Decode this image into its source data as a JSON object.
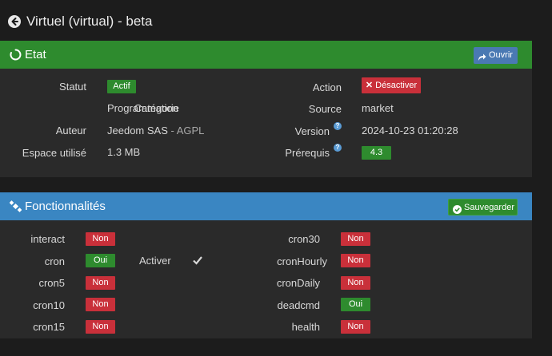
{
  "page": {
    "title": "Virtuel (virtual) - beta"
  },
  "etat": {
    "title": "Etat",
    "open_label": "Ouvrir",
    "status_label": "Statut",
    "status_value": "Actif",
    "category_label": "Catégorie",
    "category_value": "Programmation",
    "author_label": "Auteur",
    "author_name": "Jeedom SAS",
    "author_license": " - AGPL",
    "space_label": "Espace utilisé",
    "space_value": "1.3 MB",
    "action_label": "Action",
    "action_button": "Désactiver",
    "source_label": "Source",
    "source_value": "market",
    "version_label": "Version",
    "version_value": "2024-10-23 01:20:28",
    "prereq_label": "Prérequis",
    "prereq_value": "4.3",
    "help_glyph": "?"
  },
  "features": {
    "title": "Fonctionnalités",
    "save_label": "Sauvegarder",
    "activate_label": "Activer",
    "left": [
      {
        "name": "interact",
        "value": "Non"
      },
      {
        "name": "cron",
        "value": "Oui"
      },
      {
        "name": "cron5",
        "value": "Non"
      },
      {
        "name": "cron10",
        "value": "Non"
      },
      {
        "name": "cron15",
        "value": "Non"
      }
    ],
    "right": [
      {
        "name": "cron30",
        "value": "Non"
      },
      {
        "name": "cronHourly",
        "value": "Non"
      },
      {
        "name": "cronDaily",
        "value": "Non"
      },
      {
        "name": "deadcmd",
        "value": "Oui"
      },
      {
        "name": "health",
        "value": "Non"
      }
    ]
  },
  "colors": {
    "green": "#2e8b2e",
    "red": "#c9303a",
    "blue_header": "#3a86c2",
    "ouvrir_btn": "#4a79b3"
  }
}
